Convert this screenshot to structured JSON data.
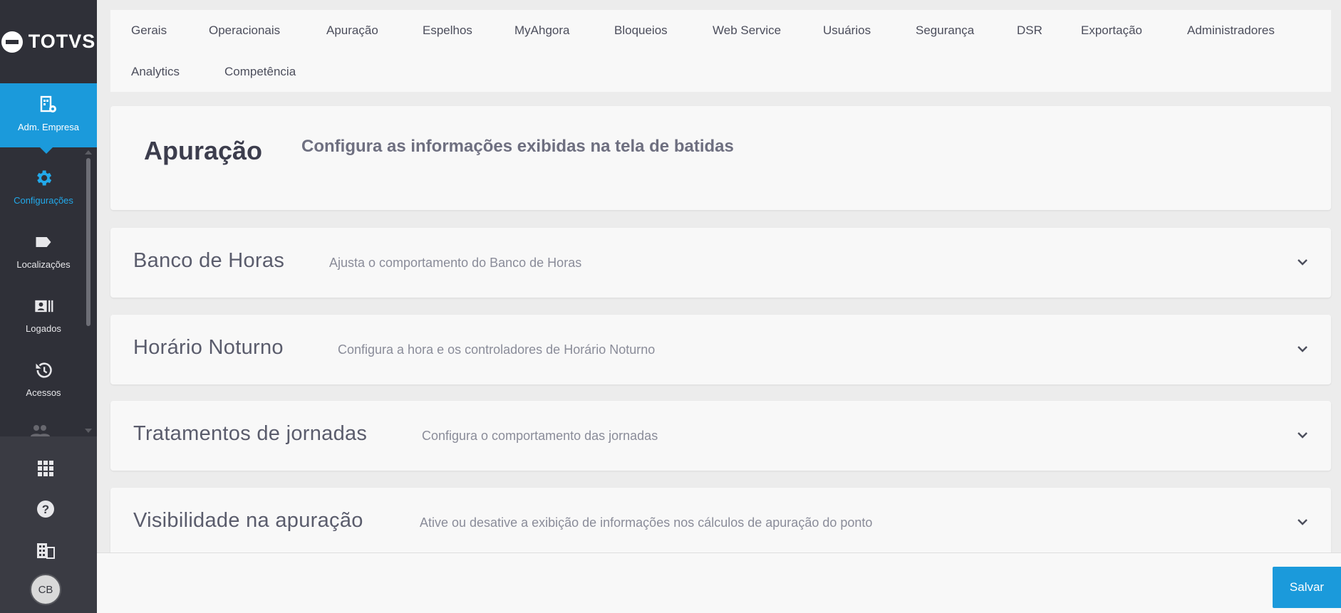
{
  "brand": {
    "name": "TOTVS"
  },
  "sidebar": {
    "active_module": {
      "label": "Adm. Empresa",
      "icon": "building-gear-icon"
    },
    "items": [
      {
        "label": "Configurações",
        "icon": "gear-icon",
        "current": true
      },
      {
        "label": "Localizações",
        "icon": "tag-icon"
      },
      {
        "label": "Logados",
        "icon": "badge-list-icon"
      },
      {
        "label": "Acessos",
        "icon": "history-icon"
      }
    ],
    "bottom_icons": [
      "apps-grid-icon",
      "help-icon",
      "company-icon"
    ],
    "user_initials": "CB"
  },
  "tabs": [
    "Gerais",
    "Operacionais",
    "Apuração",
    "Espelhos",
    "MyAhgora",
    "Bloqueios",
    "Web Service",
    "Usuários",
    "Segurança",
    "DSR",
    "Exportação",
    "Administradores",
    "Analytics",
    "Competência"
  ],
  "page": {
    "title": "Apuração",
    "subtitle": "Configura as informações exibidas na tela de batidas"
  },
  "sections": [
    {
      "title": "Banco de Horas",
      "description": "Ajusta o comportamento do Banco de Horas"
    },
    {
      "title": "Horário Noturno",
      "description": "Configura a hora e os controladores de Horário Noturno"
    },
    {
      "title": "Tratamentos de jornadas",
      "description": "Configura o comportamento das jornadas"
    },
    {
      "title": "Visibilidade na apuração",
      "description": "Ative ou desative a exibição de informações nos cálculos de apuração do ponto"
    }
  ],
  "footer": {
    "save_label": "Salvar"
  },
  "colors": {
    "accent": "#1b9adb",
    "sidebar": "#2f3038",
    "active_text": "#22a9ea"
  }
}
